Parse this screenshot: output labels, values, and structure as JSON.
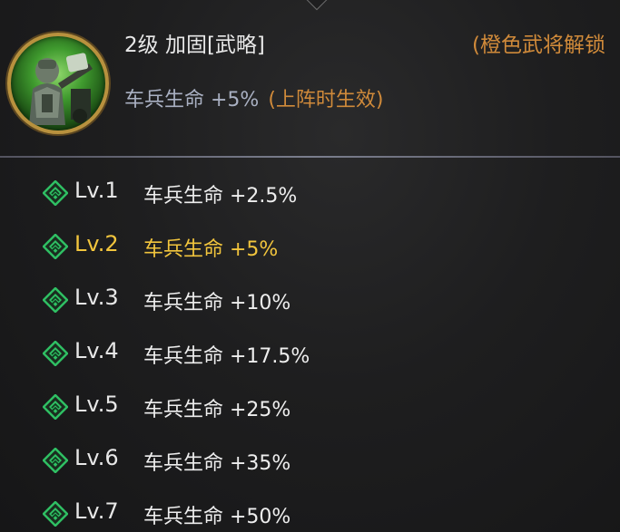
{
  "skill": {
    "title": "2级 加固[武略]",
    "unlock_note": "(橙色武将解锁",
    "current_effect": "车兵生命 +5%",
    "condition": "(上阵时生效)",
    "portrait_icon": "chariot-general-portrait"
  },
  "levels": [
    {
      "label": "Lv.1",
      "effect": "车兵生命 +2.5%",
      "active": false
    },
    {
      "label": "Lv.2",
      "effect": "车兵生命 +5%",
      "active": true
    },
    {
      "label": "Lv.3",
      "effect": "车兵生命 +10%",
      "active": false
    },
    {
      "label": "Lv.4",
      "effect": "车兵生命 +17.5%",
      "active": false
    },
    {
      "label": "Lv.5",
      "effect": "车兵生命 +25%",
      "active": false
    },
    {
      "label": "Lv.6",
      "effect": "车兵生命 +35%",
      "active": false
    },
    {
      "label": "Lv.7",
      "effect": "车兵生命 +50%",
      "active": false
    }
  ],
  "colors": {
    "active_level": "#f2c53d",
    "condition_text": "#d08a3a",
    "bullet_icon": "#2fbf63",
    "portrait_glow": "#3f9a2e"
  }
}
